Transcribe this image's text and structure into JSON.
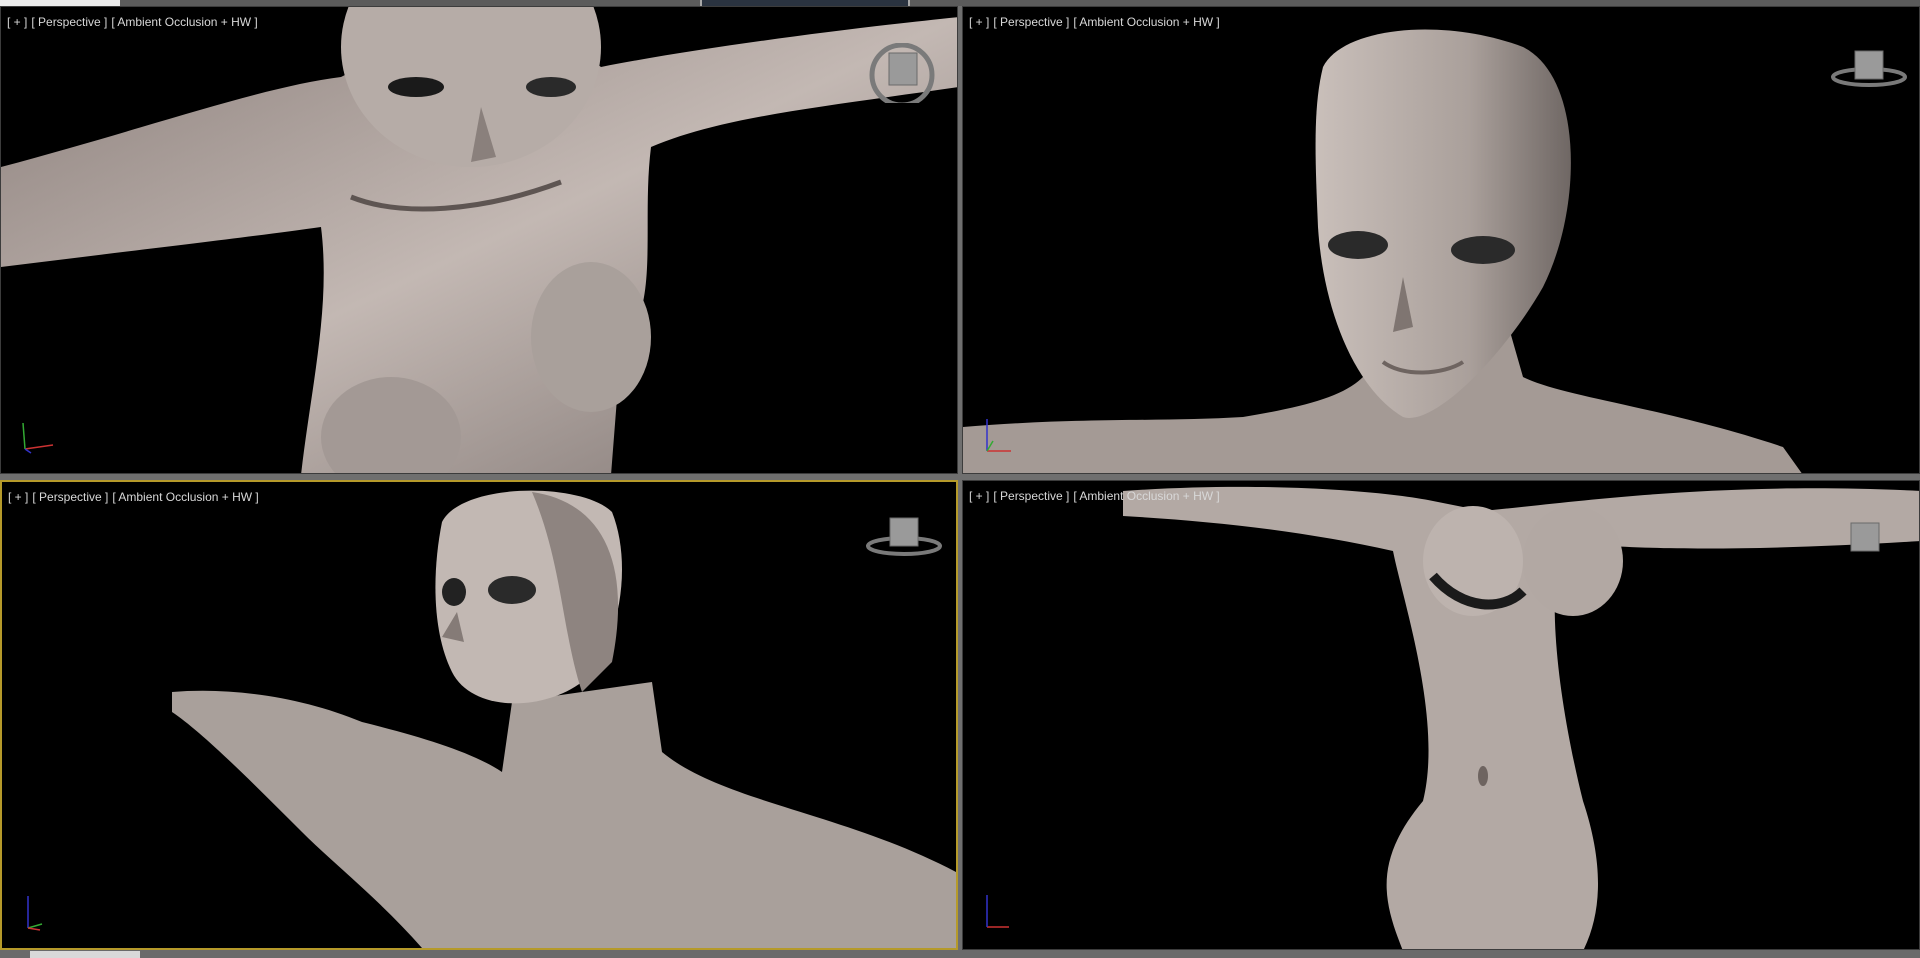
{
  "viewports": [
    {
      "id": "top-left",
      "plus": "[ + ]",
      "view": "[ Perspective ]",
      "shading": "[ Ambient Occlusion + HW ]"
    },
    {
      "id": "top-right",
      "plus": "[ + ]",
      "view": "[ Perspective ]",
      "shading": "[ Ambient Occlusion + HW ]"
    },
    {
      "id": "bottom-left",
      "plus": "[ + ]",
      "view": "[ Perspective ]",
      "shading": "[ Ambient Occlusion + HW ]"
    },
    {
      "id": "bottom-right",
      "plus": "[ + ]",
      "view": "[ Perspective ]",
      "shading": "[ Ambient Occlusion + HW ]"
    }
  ],
  "active_viewport": "bottom-left",
  "icons": [
    "viewcube-icon",
    "axis-tripod-icon"
  ],
  "colors": {
    "viewport_bg": "#000000",
    "active_border": "#b59a2a",
    "mesh": "#bdb3ae",
    "label": "#d8d8d8"
  }
}
